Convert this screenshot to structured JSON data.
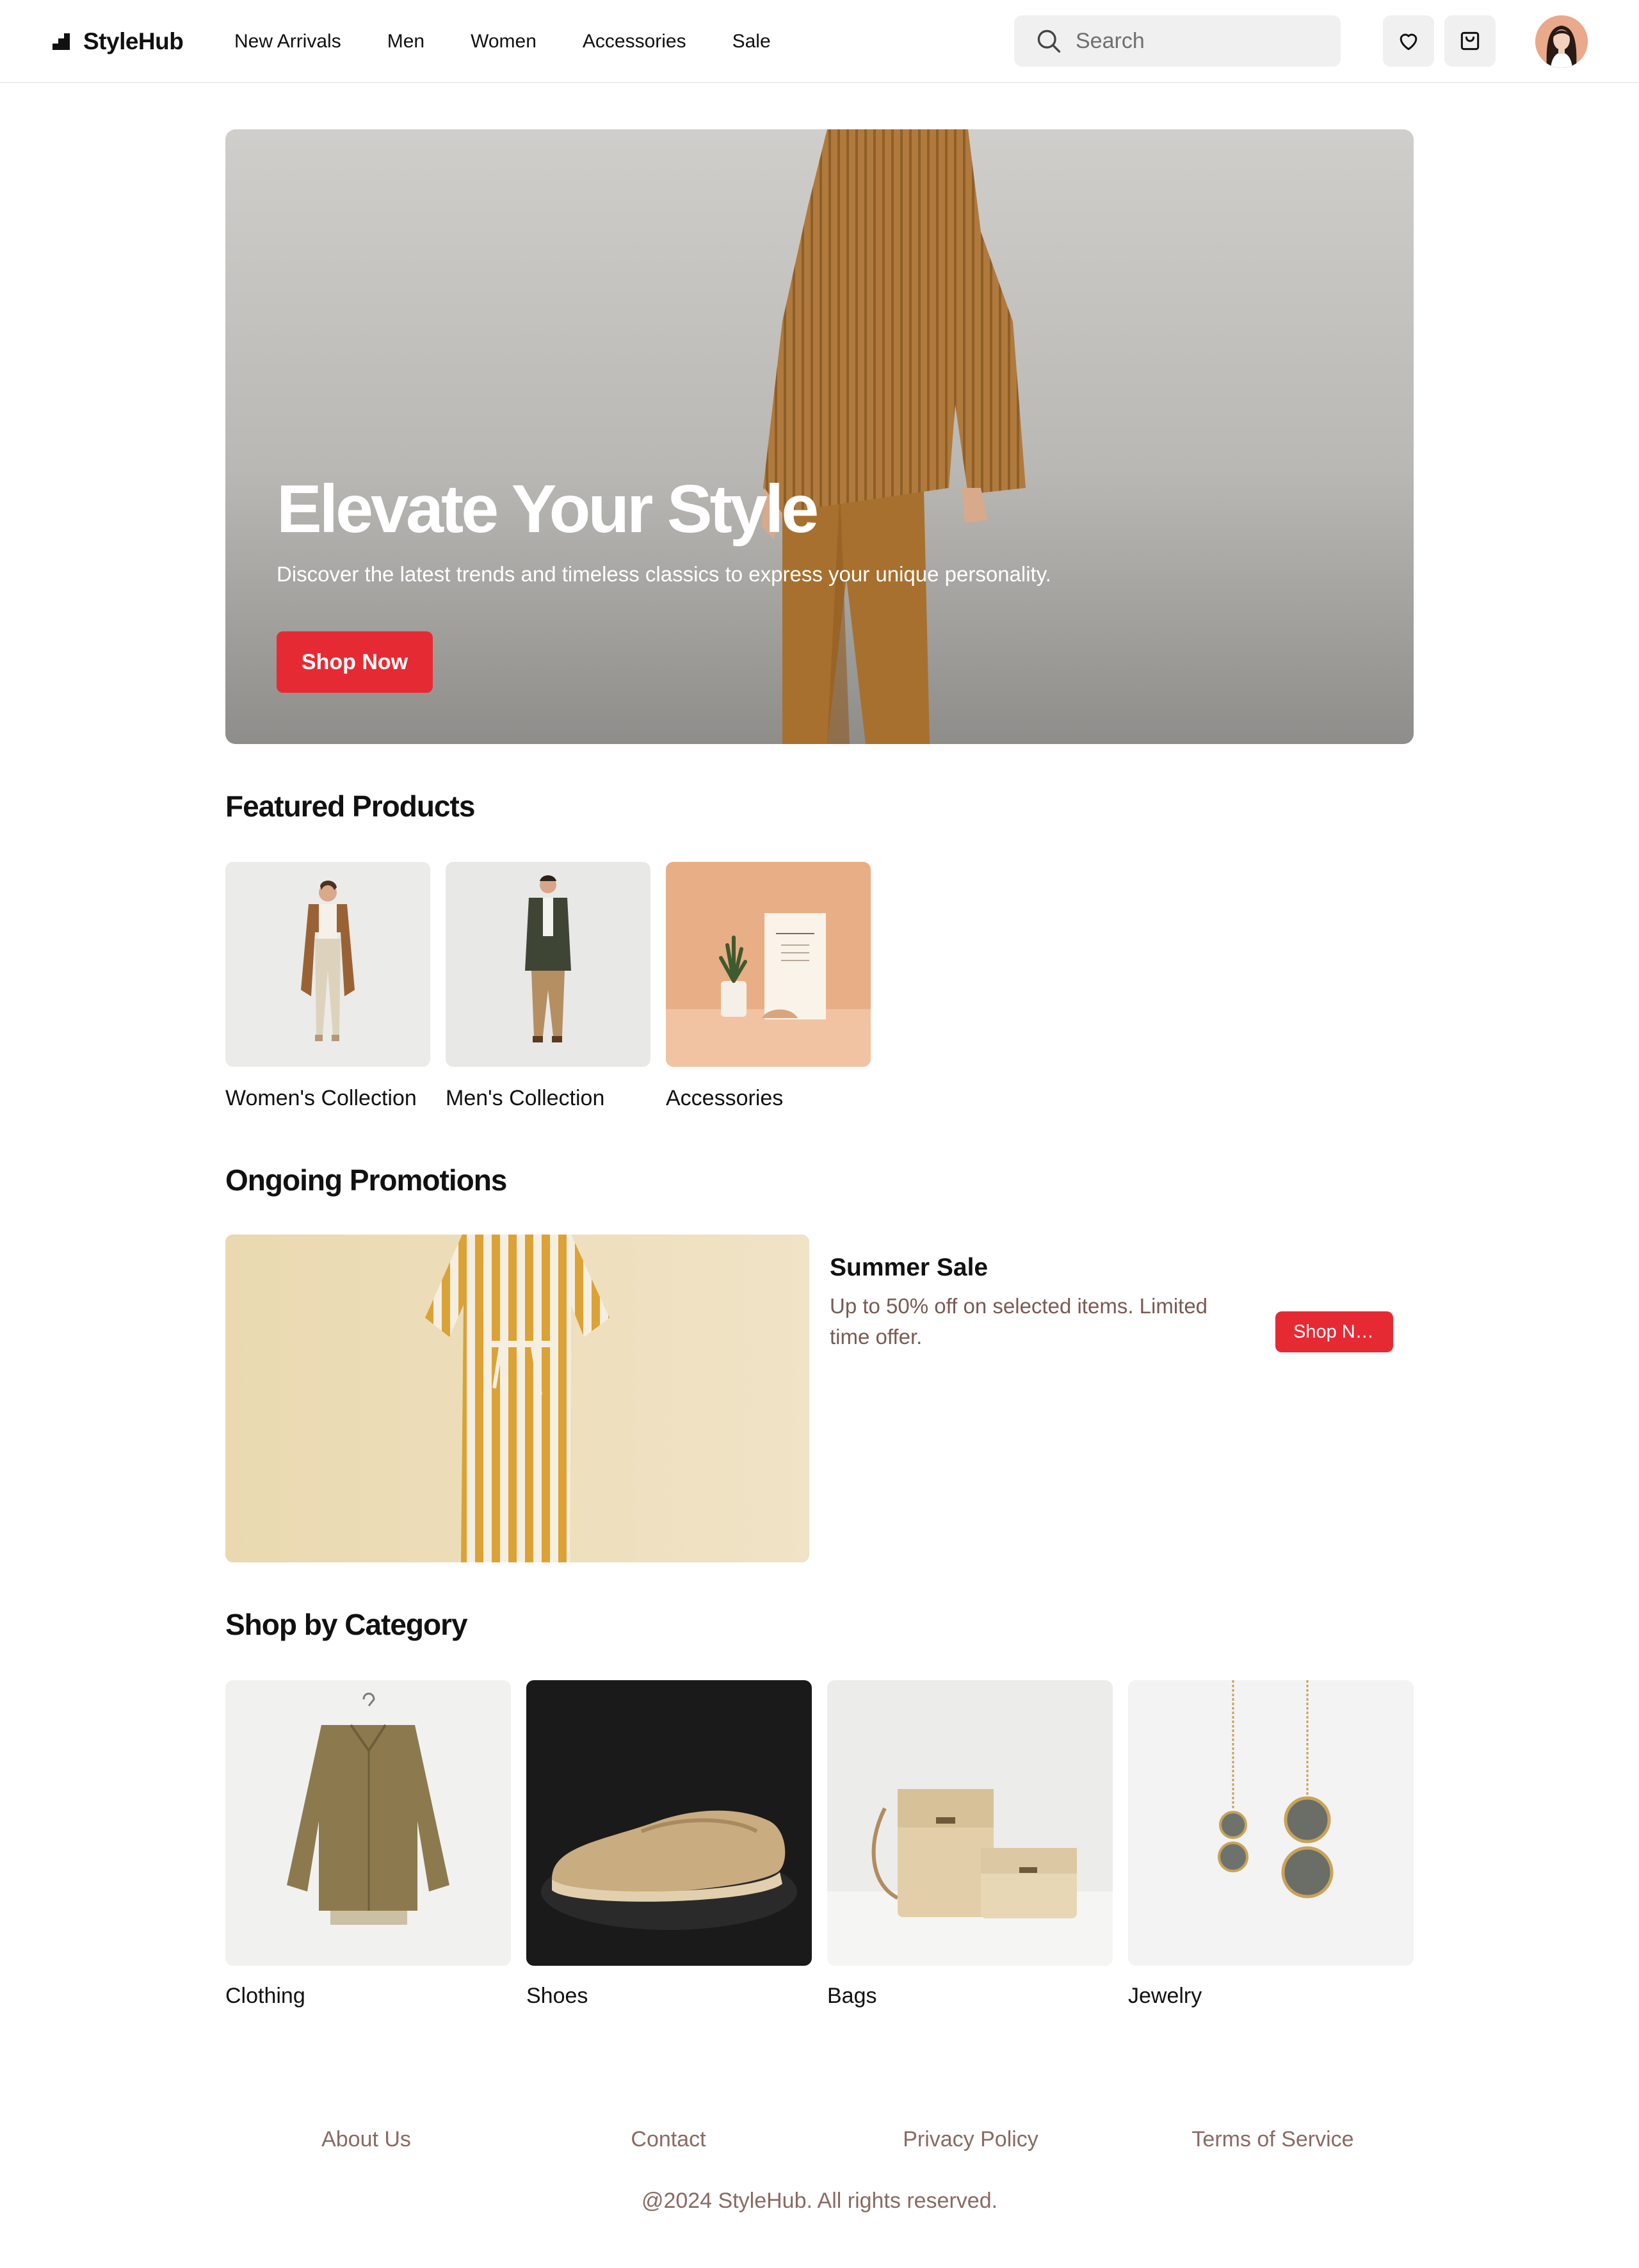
{
  "header": {
    "brand": "StyleHub",
    "nav": [
      "New Arrivals",
      "Men",
      "Women",
      "Accessories",
      "Sale"
    ],
    "search_placeholder": "Search",
    "icons": [
      "heart-icon",
      "cart-icon"
    ]
  },
  "hero": {
    "title": "Elevate Your Style",
    "subtitle": "Discover the latest trends and timeless classics to express your unique personality.",
    "cta": "Shop Now"
  },
  "featured": {
    "title": "Featured Products",
    "items": [
      {
        "label": "Women's Collection"
      },
      {
        "label": "Men's Collection"
      },
      {
        "label": "Accessories"
      }
    ]
  },
  "promotions": {
    "title": "Ongoing Promotions",
    "item": {
      "title": "Summer Sale",
      "description": "Up to 50% off on selected items. Limited time offer.",
      "cta": "Shop Now"
    }
  },
  "categories": {
    "title": "Shop by Category",
    "items": [
      {
        "label": "Clothing"
      },
      {
        "label": "Shoes"
      },
      {
        "label": "Bags"
      },
      {
        "label": "Jewelry"
      }
    ]
  },
  "footer": {
    "links": [
      "About Us",
      "Contact",
      "Privacy Policy",
      "Terms of Service"
    ],
    "copyright": "@2024 StyleHub. All rights reserved."
  },
  "colors": {
    "accent": "#e62a34",
    "footer_text": "#8a6a62",
    "text": "#111111"
  }
}
